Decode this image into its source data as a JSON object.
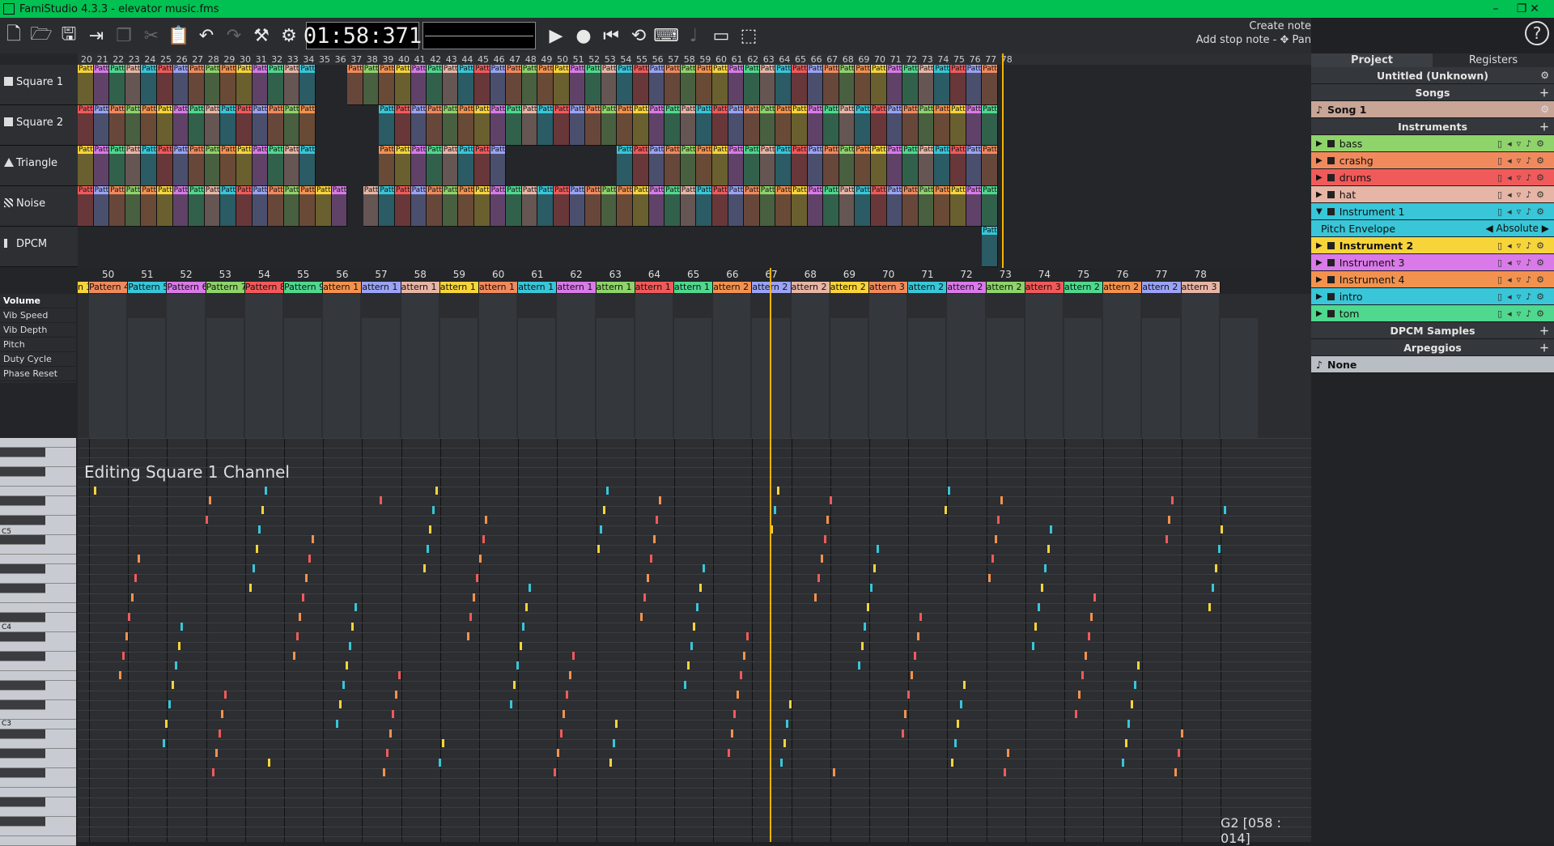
{
  "window": {
    "title": "FamiStudio 4.3.3 - elevator music.fms",
    "controls": [
      "–",
      "❐",
      "✕"
    ]
  },
  "toolbar": {
    "timer": "01:58:371",
    "buttons": [
      "new-file-icon",
      "open-file-icon",
      "save-icon",
      "export-icon",
      "copy-icon",
      "cut-icon",
      "paste-icon",
      "undo-icon",
      "redo-icon",
      "transform-icon",
      "config-icon"
    ],
    "transport": [
      "play-icon",
      "record-icon",
      "rewind-icon",
      "loop-icon",
      "qwerty-icon",
      "metronome-icon",
      "machine-icon",
      "follow-icon"
    ],
    "hints": {
      "line1": "Create note",
      "line2": "Add stop note - ✥ Pan"
    }
  },
  "sequencer": {
    "channels": [
      "Square 1",
      "Square 2",
      "Triangle",
      "Noise",
      "DPCM"
    ],
    "ruler_start": 20,
    "ruler_end": 78
  },
  "pianoroll": {
    "ruler_start": 50,
    "ruler_end": 78,
    "patterns": [
      "n 3",
      "Pattern 4",
      "Pattern 5",
      "Pattern 6",
      "Pattern 7",
      "Pattern 8",
      "Pattern 9",
      "attern 1",
      "attern 1",
      "attern 1",
      "attern 1",
      "attern 1",
      "attern 1",
      "attern 1",
      "attern 1",
      "attern 1",
      "attern 1",
      "attern 2",
      "attern 2",
      "attern 2",
      "attern 2",
      "attern 3",
      "attern 2",
      "attern 2",
      "attern 2",
      "attern 3",
      "attern 2",
      "attern 2",
      "attern 2",
      "attern 3"
    ],
    "envelopes": [
      "Volume",
      "Vib Speed",
      "Vib Depth",
      "Pitch",
      "Duty Cycle",
      "Phase Reset"
    ],
    "editing_label": "Editing Square 1 Channel",
    "status": "G2 [058 : 014]",
    "key_labels": [
      "C5",
      "C4",
      "C3"
    ]
  },
  "project": {
    "tabs": [
      "Project",
      "Registers"
    ],
    "project_name": "Untitled (Unknown)",
    "songs_header": "Songs",
    "songs": [
      "Song 1"
    ],
    "instruments_header": "Instruments",
    "instruments": [
      {
        "name": "bass",
        "color": "#8fd36b"
      },
      {
        "name": "crashg",
        "color": "#f08a5d"
      },
      {
        "name": "drums",
        "color": "#f05a5a"
      },
      {
        "name": "hat",
        "color": "#e7b5a5"
      },
      {
        "name": "Instrument 1",
        "color": "#38c6d8"
      },
      {
        "name": "Instrument 2",
        "color": "#f7d43a"
      },
      {
        "name": "Instrument 3",
        "color": "#d97ae8"
      },
      {
        "name": "Instrument 4",
        "color": "#f3924e"
      },
      {
        "name": "intro",
        "color": "#38c6d8"
      },
      {
        "name": "tom",
        "color": "#4fd88e"
      }
    ],
    "pitch_envelope": {
      "label": "Pitch Envelope",
      "value": "Absolute"
    },
    "dpcm_header": "DPCM Samples",
    "arp_header": "Arpeggios",
    "arpeggios": [
      "None"
    ]
  }
}
